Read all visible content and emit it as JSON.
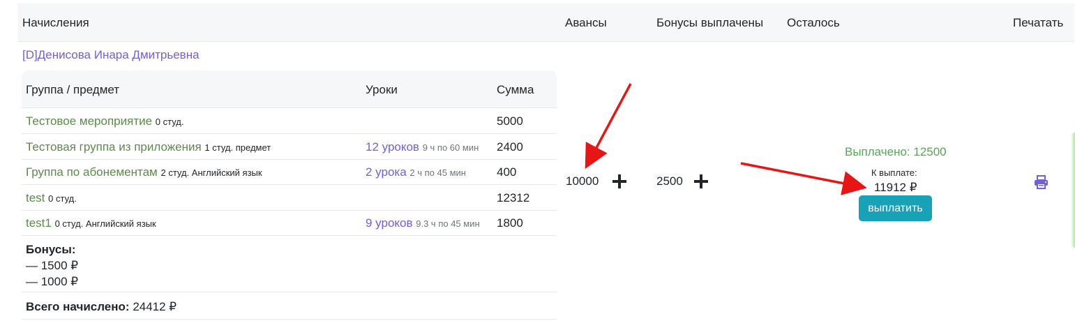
{
  "header": {
    "accruals": "Начисления",
    "advances": "Авансы",
    "bonuses_paid": "Бонусы выплачены",
    "remaining": "Осталось",
    "print": "Печатать"
  },
  "teacher": {
    "name": "[D]Денисова Инара Дмитрьевна"
  },
  "table": {
    "headers": {
      "group": "Группа / предмет",
      "lessons": "Уроки",
      "sum": "Сумма"
    },
    "rows": [
      {
        "name": "Тестовое мероприятие",
        "meta": "0 студ.",
        "lessons_link": "",
        "lessons_meta": "",
        "sum": "5000"
      },
      {
        "name": "Тестовая группа из приложения",
        "meta": "1 студ. предмет",
        "lessons_link": "12 уроков",
        "lessons_meta": "9 ч по 60 мин",
        "sum": "2400"
      },
      {
        "name": "Группа по абонементам",
        "meta": "2 студ. Английский язык",
        "lessons_link": "2 урока",
        "lessons_meta": "2 ч по 45 мин",
        "sum": "400"
      },
      {
        "name": "test",
        "meta": "0 студ.",
        "lessons_link": "",
        "lessons_meta": "",
        "sum": "12312"
      },
      {
        "name": "test1",
        "meta": "0 студ. Английский язык",
        "lessons_link": "9 уроков",
        "lessons_meta": "9.3 ч по 45 мин",
        "sum": "1800"
      }
    ],
    "bonuses": {
      "title": "Бонусы:",
      "items": [
        "— 1500 ₽",
        "— 1000 ₽"
      ]
    },
    "total": {
      "label": "Всего начислено:",
      "value": "24412 ₽"
    }
  },
  "summary": {
    "advances": "10000",
    "bonuses_paid": "2500",
    "paid_out": "Выплачено: 12500",
    "to_pay_label": "К выплате:",
    "to_pay_value": "11912 ₽",
    "pay_button": "выплатить"
  },
  "colors": {
    "link_purple": "#6f5fe3",
    "link_green": "#5b8a4a",
    "paid_green": "#5aa35a",
    "pay_button": "#17a2b8",
    "arrow_red": "#e81515"
  },
  "icons": {
    "print": "printer-icon",
    "plus": "plus-icon"
  }
}
